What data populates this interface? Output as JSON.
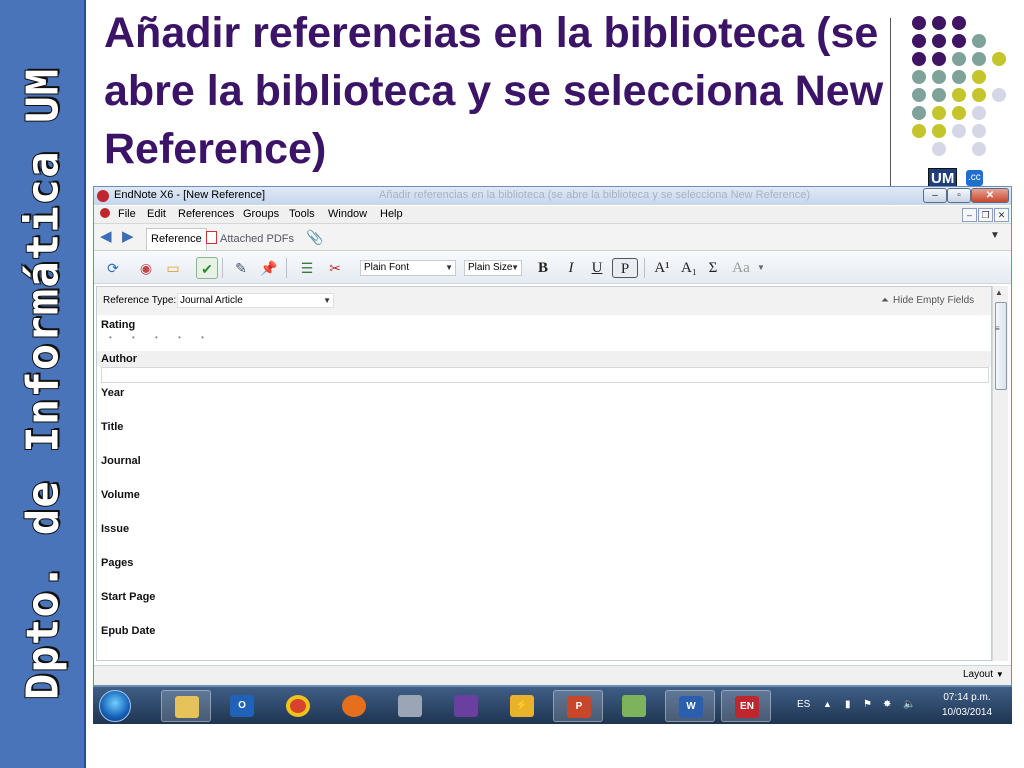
{
  "slide": {
    "side_banner_text": "Dpto. de Informática UM",
    "title": "Añadir referencias en la biblioteca (se abre la biblioteca y se selecciona New Reference)",
    "logo_text": "UM",
    "logo_sub": ".cc",
    "dot_colors": {
      "purple": "#3f1463",
      "teal": "#7fa39a",
      "lime": "#c4c52b",
      "lavender": "#d5d6e6"
    },
    "banner_color": "#4a74b9",
    "title_color": "#3b1468"
  },
  "window": {
    "title": "EndNote X6 - [New Reference]",
    "title_ghost": "Añadir referencias en la biblioteca (se abre la biblioteca y se selecciona New Reference)",
    "controls": {
      "minimize": "–",
      "maximize": "▫",
      "close": "✕"
    },
    "menu": [
      "File",
      "Edit",
      "References",
      "Groups",
      "Tools",
      "Window",
      "Help"
    ],
    "mdi_controls": {
      "minimize": "–",
      "restore": "❐",
      "close": "✕"
    },
    "tabs": {
      "reference": "Reference",
      "attached_pdfs": "Attached PDFs"
    },
    "toolbar": {
      "font_combo": "Plain Font",
      "size_combo": "Plain Size",
      "bold": "B",
      "italic": "I",
      "underline": "U",
      "plain": "P",
      "superscript": "A¹",
      "subscript": "A₁",
      "symbol": "Σ",
      "case": "Aa"
    },
    "reference_type_label": "Reference Type:",
    "reference_type_value": "Journal Article",
    "hide_empty_fields": "Hide Empty Fields",
    "fields": [
      "Rating",
      "Author",
      "Year",
      "Title",
      "Journal",
      "Volume",
      "Issue",
      "Pages",
      "Start Page",
      "Epub Date"
    ],
    "rating_stars": "• • • • •",
    "layout_label": "Layout"
  },
  "taskbar": {
    "apps": [
      "windows-explorer",
      "outlook",
      "chrome",
      "firefox",
      "utility",
      "visual-studio",
      "winamp",
      "powerpoint",
      "notepad",
      "word",
      "endnote"
    ],
    "language": "ES",
    "time": "07:14 p.m.",
    "date": "10/03/2014"
  }
}
